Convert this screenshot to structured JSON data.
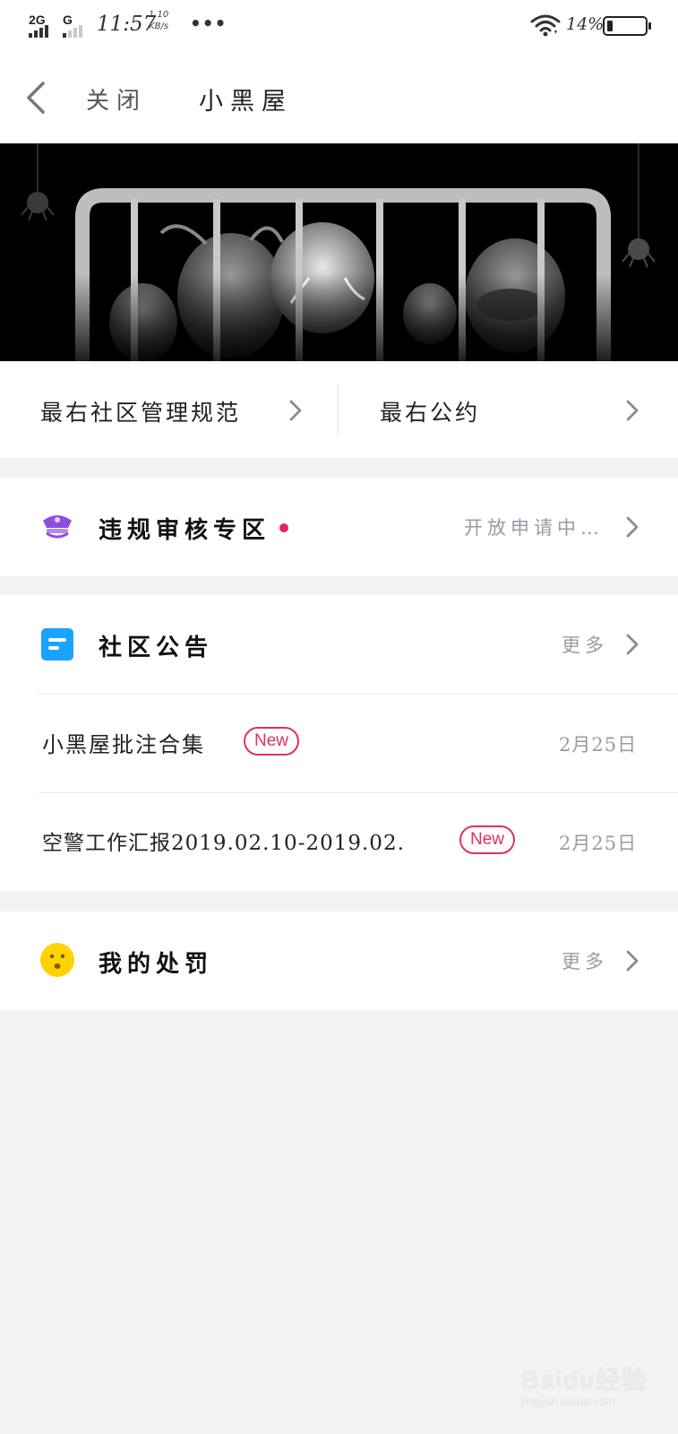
{
  "status_bar": {
    "network_1": "2G",
    "network_2": "G",
    "time": "11:57",
    "speed_value": "1.10",
    "speed_unit": "KB/s",
    "more": "•••",
    "battery_percent": "14%",
    "battery_level": 0.14
  },
  "nav": {
    "back_icon": "chevron-left-icon",
    "close_label": "关闭",
    "title": "小黑屋"
  },
  "banner": {
    "image": "cartoon characters behind jail bars"
  },
  "rules": {
    "left_label": "最右社区管理规范",
    "right_label": "最右公约"
  },
  "review_zone": {
    "icon": "police-cap-icon",
    "title": "违规审核专区",
    "status": "开放申请中…",
    "dot_color": "#e8215a"
  },
  "announcements": {
    "icon": "document-icon",
    "title": "社区公告",
    "more_label": "更多",
    "items": [
      {
        "text": "小黑屋批注合集",
        "badge": "New",
        "date": "2月25日"
      },
      {
        "text": "空警工作汇报2019.02.10-2019.02.",
        "badge": "New",
        "date": "2月25日"
      }
    ]
  },
  "penalties": {
    "icon": "sad-face-icon",
    "title": "我的处罚",
    "more_label": "更多"
  },
  "colors": {
    "accent_red": "#e1305e",
    "icon_purple": "#8d4de0",
    "icon_blue": "#1aa3ff",
    "icon_yellow": "#ffd200"
  },
  "watermark": {
    "main": "Baidu经验",
    "sub": "jingyan.baidu.com"
  }
}
